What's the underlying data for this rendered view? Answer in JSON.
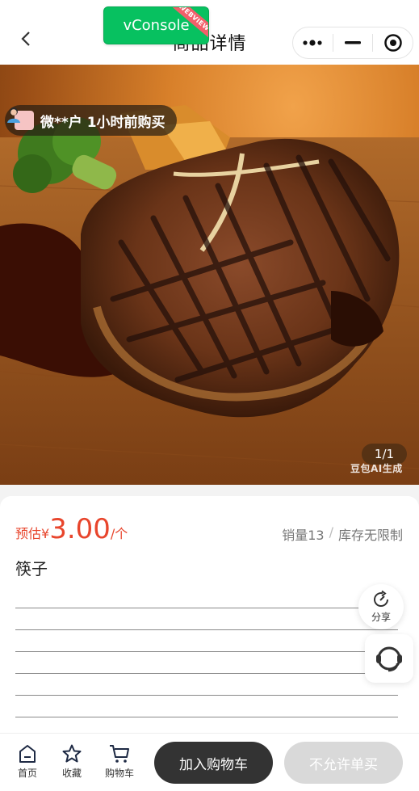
{
  "header": {
    "title": "商品详情",
    "back_icon": "chevron-left-icon",
    "capsule": {
      "more_icon": "more-dots-icon",
      "minimize_icon": "minimize-icon",
      "close_icon": "target-close-icon"
    }
  },
  "debug": {
    "vconsole_label": "vConsole",
    "ribbon_text": "WEBVIEW"
  },
  "gallery": {
    "buyer_notice": "微**户 1小时前购买",
    "counter": "1/1",
    "watermark": "豆包AI生成"
  },
  "product": {
    "price_prefix": "预估",
    "currency": "¥",
    "price": "3.00",
    "unit": "/个",
    "sales": "销量13",
    "stock": "库存无限制",
    "name": "筷子",
    "description_lines": 7
  },
  "floating": {
    "share_label": "分享",
    "service_icon": "headset-icon"
  },
  "bottom_bar": {
    "tabs": [
      {
        "label": "首页",
        "icon": "home-icon"
      },
      {
        "label": "收藏",
        "icon": "star-icon"
      },
      {
        "label": "购物车",
        "icon": "cart-icon"
      }
    ],
    "add_cart_label": "加入购物车",
    "buy_label": "不允许单买"
  },
  "colors": {
    "price": "#e8452c",
    "vconsole": "#07c160",
    "primary_button": "#333333",
    "disabled_button": "#d9d9d9"
  }
}
